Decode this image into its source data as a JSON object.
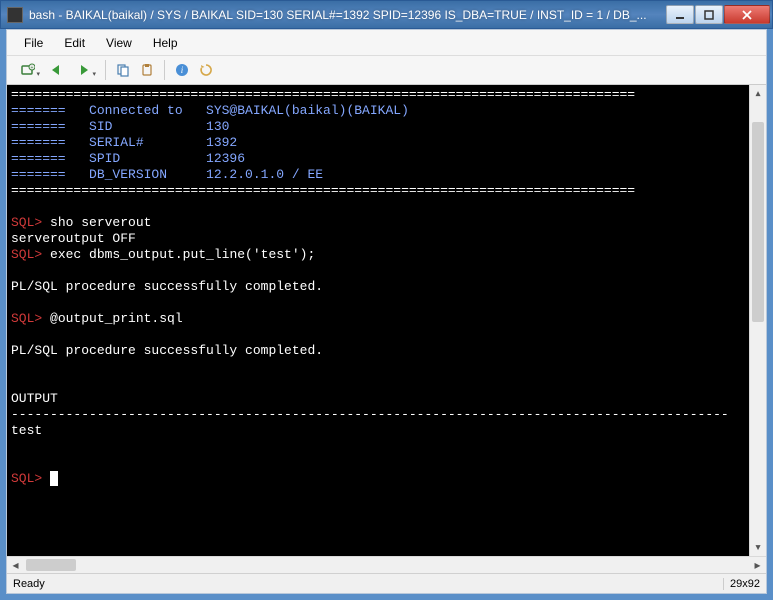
{
  "window": {
    "title": "bash - BAIKAL(baikal) / SYS / BAIKAL   SID=130   SERIAL#=1392    SPID=12396    IS_DBA=TRUE / INST_ID = 1 / DB_..."
  },
  "menu": {
    "file": "File",
    "edit": "Edit",
    "view": "View",
    "help": "Help"
  },
  "toolbar_icons": {
    "new_session": "new-session-icon",
    "back": "back-icon",
    "forward": "forward-icon",
    "copy": "copy-icon",
    "paste": "paste-icon",
    "info": "info-icon",
    "refresh": "refresh-icon"
  },
  "terminal": {
    "prompt_text": "SQL>",
    "lines": {
      "rule_eq": "================================================================================",
      "hdr_conn": "=======   Connected to   SYS@BAIKAL(baikal)(BAIKAL)",
      "hdr_sid": "=======   SID            130",
      "hdr_serial": "=======   SERIAL#        1392",
      "hdr_spid": "=======   SPID           12396",
      "hdr_ver": "=======   DB_VERSION     12.2.0.1.0 / EE",
      "cmd1": " sho serverout",
      "out1": "serveroutput OFF",
      "cmd2": " exec dbms_output.put_line('test');",
      "plsql_ok": "PL/SQL procedure successfully completed.",
      "cmd3": " @output_print.sql",
      "output_hdr": "OUTPUT",
      "dash_rule": "--------------------------------------------------------------------------------------------",
      "output_val": "test"
    }
  },
  "status": {
    "left": "Ready",
    "right": "29x92"
  }
}
